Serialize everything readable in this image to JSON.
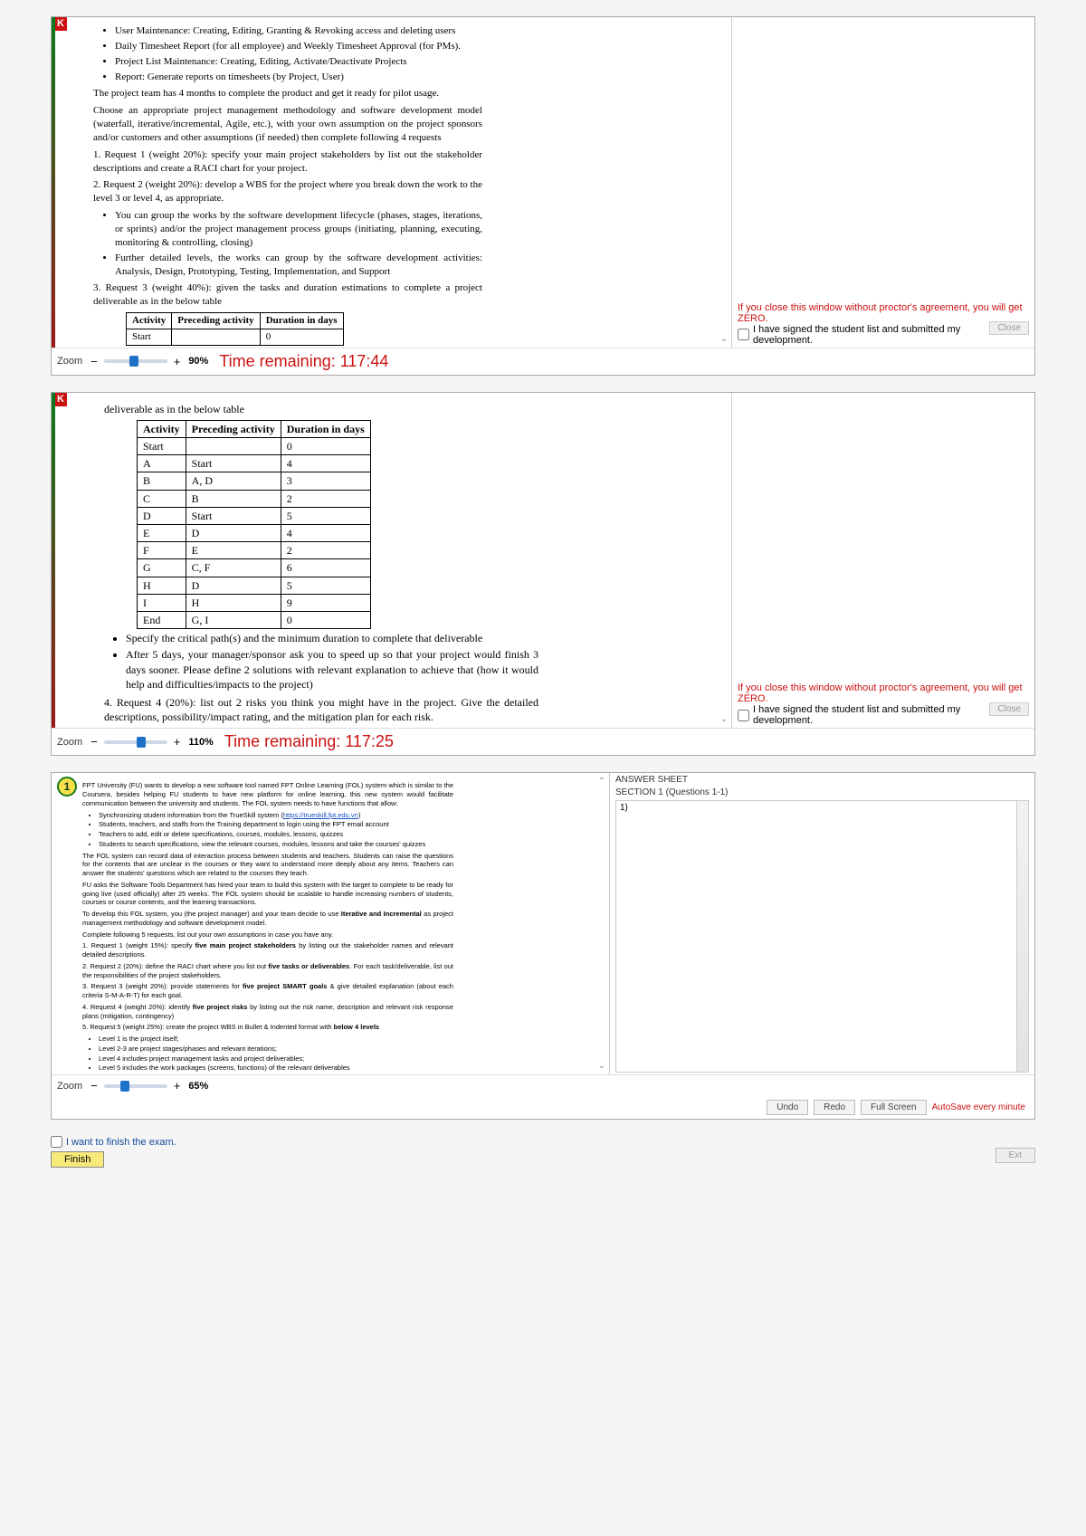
{
  "ss1": {
    "bullets_top": [
      "User Maintenance: Creating, Editing, Granting & Revoking access and deleting users",
      "Daily Timesheet Report (for all employee) and Weekly Timesheet Approval (for PMs).",
      "Project List Maintenance: Creating, Editing, Activate/Deactivate Projects",
      "Report: Generate reports on timesheets (by Project, User)"
    ],
    "para_duration": "The project team has 4 months to complete the product and get it ready for pilot usage.",
    "para_method": "Choose an appropriate project management methodology and software development model (waterfall, iterative/incremental, Agile, etc.), with your own assumption on the project sponsors and/or customers and other assumptions (if needed) then complete following 4 requests",
    "req1": "1. Request 1 (weight 20%): specify your main project stakeholders by list out the stakeholder descriptions and create a RACI chart for your project.",
    "req2": "2. Request 2 (weight 20%): develop a WBS for the project where you break down the work to the level 3 or level 4, as appropriate.",
    "wbs_bullets": [
      "You can group the works by the software development lifecycle (phases, stages, iterations, or sprints) and/or the project management process groups (initiating, planning, executing, monitoring & controlling, closing)",
      "Further detailed levels, the works can group by the software development activities: Analysis, Design, Prototyping, Testing, Implementation, and Support"
    ],
    "req3": "3. Request 3 (weight 40%): given the tasks and duration estimations to complete a project deliverable as in the below table",
    "tbl_hdr": [
      "Activity",
      "Preceding activity",
      "Duration in days"
    ],
    "tbl_row0": [
      "Start",
      "",
      "0"
    ],
    "zoom_label": "Zoom",
    "zoom_pct": "90%",
    "timer": "Time remaining: 117:44",
    "warn": "If you close this window without proctor's agreement, you will get ZERO.",
    "agree": "I have signed the student list and submitted my development.",
    "close": "Close"
  },
  "ss2": {
    "lead": "deliverable as in the below table",
    "tbl_hdr": [
      "Activity",
      "Preceding activity",
      "Duration in days"
    ],
    "rows": [
      [
        "Start",
        "",
        "0"
      ],
      [
        "A",
        "Start",
        "4"
      ],
      [
        "B",
        "A, D",
        "3"
      ],
      [
        "C",
        "B",
        "2"
      ],
      [
        "D",
        "Start",
        "5"
      ],
      [
        "E",
        "D",
        "4"
      ],
      [
        "F",
        "E",
        "2"
      ],
      [
        "G",
        "C, F",
        "6"
      ],
      [
        "H",
        "D",
        "5"
      ],
      [
        "I",
        "H",
        "9"
      ],
      [
        "End",
        "G, I",
        "0"
      ]
    ],
    "bul1": "Specify the critical path(s) and the minimum duration to complete that deliverable",
    "bul2": "After 5 days, your manager/sponsor ask you to speed up so that your project would finish 3 days sooner. Please define 2 solutions with relevant explanation to achieve that (how it would help and difficulties/impacts to the project)",
    "req4": "4. Request 4 (20%): list out 2 risks you think you might have in the project. Give the detailed descriptions, possibility/impact rating, and the mitigation plan for each risk.",
    "zoom_label": "Zoom",
    "zoom_pct": "110%",
    "timer": "Time remaining: 117:25",
    "warn": "If you close this window without proctor's agreement, you will get ZERO.",
    "agree": "I have signed the student list and submitted my development.",
    "close": "Close"
  },
  "ss3": {
    "qnum": "1",
    "p1a": "FPT University (FU) wants to develop a new software tool named FPT Online Learning (FOL) system which is similar to the Coursera, besides helping FU students to have new platform for online learning, this new system would facilitate communication between the university and students. The FOL system needs to have functions that allow:",
    "b1": [
      "Synchronizing student information from the TrueSkill system (",
      "https://trueskill.fpt.edu.vn",
      ")",
      "Students, teachers, and staffs from the Training department to login using the FPT email account",
      "Teachers to add, edit or delete specifications, courses, modules, lessons, quizzes",
      "Students to search specifications, view the relevant courses, modules, lessons and take the courses' quizzes"
    ],
    "p2": "The FOL system can record data of interaction process between students and teachers. Students can raise the questions for the contents that are unclear in the courses or they want to understand more deeply about any items. Teachers can answer the students' questions which are related to the courses they teach.",
    "p3": "FU asks the Software Tools Department has hired your team to build this system with the target to complete to be ready for going live (used officially) after 25 weeks. The FOL system should be scalable to handle increasing numbers of students, courses or course contents, and the learning transactions.",
    "p4a": "To develop this FOL system, you (the project manager) and your team decide to use ",
    "p4b": "Iterative and Incremental",
    "p4c": " as project management methodology and software development model.",
    "p5": "Complete following 5 requests, list out your own assumptions in case you have any.",
    "p6a": "1. Request 1 (weight 15%): specify ",
    "p6b": "five main project stakeholders",
    "p6c": " by listing out the stakeholder names and relevant detailed descriptions.",
    "p7a": "2. Request 2 (20%): define the RACI chart where you list out ",
    "p7b": "five tasks or deliverables",
    "p7c": ". For each task/deliverable, list out the responsibilities of the project stakeholders.",
    "p8a": "3. Request 3 (weight 20%): provide statements for ",
    "p8b": "five project SMART goals",
    "p8c": " & give detailed explanation (about each criteria S-M-A-R-T) for each goal.",
    "p9a": "4. Request 4 (weight 20%): identify ",
    "p9b": "five project risks",
    "p9c": " by listing out the risk name, description and relevant risk response plans (mitigation, contingency)",
    "p10a": "5. Request 5 (weight 25%): create the project WBS in Bullet & Indented format with ",
    "p10b": "below 4 levels",
    "lvls": [
      "Level 1 is the project itself;",
      "Level 2-3 are project stages/phases and relevant iterations;",
      "Level 4 includes project management tasks and project deliverables;",
      "Level 5 includes the work packages (screens, functions) of the relevant deliverables"
    ],
    "ans_hdr": "ANSWER SHEET",
    "section": "SECTION 1 (Questions 1-1)",
    "ans_init": "1)",
    "zoom_label": "Zoom",
    "zoom_pct": "65%",
    "undo": "Undo",
    "redo": "Redo",
    "full": "Full Screen",
    "autosave": "AutoSave every minute",
    "finish_chk": "I want to finish the exam.",
    "finish_btn": "Finish",
    "ext": "Ext"
  }
}
